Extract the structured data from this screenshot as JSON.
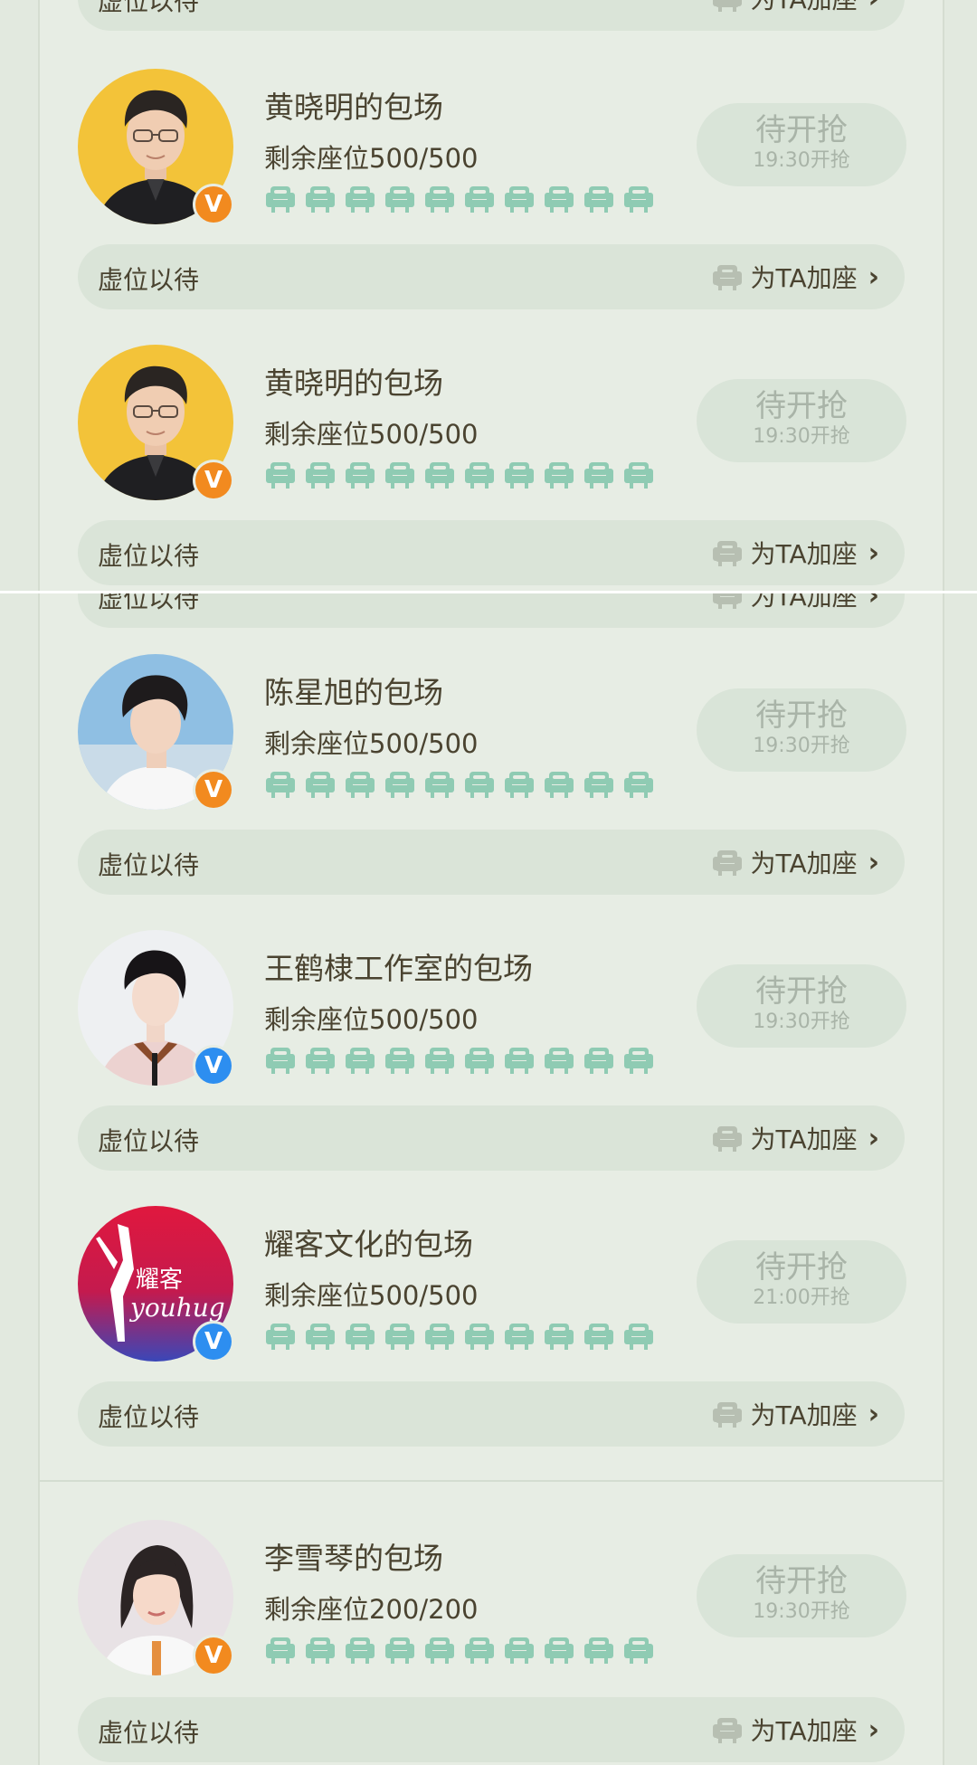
{
  "seat_color": "#8fcbb3",
  "accent_colors": {
    "badge_orange": "#f28a1f",
    "badge_blue": "#2d8ef0",
    "status_bg": "#d9e4d8",
    "strip_bg": "#dae4d8"
  },
  "top_partial_strip": {
    "left": "虚位以待",
    "right": "为TA加座"
  },
  "cut_partial_strip": {
    "left": "虚位以待",
    "right": "为TA加座"
  },
  "cards": [
    {
      "title": "黄晓明的包场",
      "seats": "剩余座位500/500",
      "status": "待开抢",
      "time": "19:30开抢",
      "badge": "V",
      "waiting": "虚位以待",
      "add_seat": "为TA加座",
      "seat_icons": 10
    },
    {
      "title": "黄晓明的包场",
      "seats": "剩余座位500/500",
      "status": "待开抢",
      "time": "19:30开抢",
      "badge": "V",
      "waiting": "虚位以待",
      "add_seat": "为TA加座",
      "seat_icons": 10
    },
    {
      "title": "陈星旭的包场",
      "seats": "剩余座位500/500",
      "status": "待开抢",
      "time": "19:30开抢",
      "badge": "V",
      "waiting": "虚位以待",
      "add_seat": "为TA加座",
      "seat_icons": 10
    },
    {
      "title": "王鹤棣工作室的包场",
      "seats": "剩余座位500/500",
      "status": "待开抢",
      "time": "19:30开抢",
      "badge": "V",
      "waiting": "虚位以待",
      "add_seat": "为TA加座",
      "seat_icons": 10
    },
    {
      "title": "耀客文化的包场",
      "seats": "剩余座位500/500",
      "status": "待开抢",
      "time": "21:00开抢",
      "badge": "V",
      "waiting": "虚位以待",
      "add_seat": "为TA加座",
      "seat_icons": 10
    },
    {
      "title": "李雪琴的包场",
      "seats": "剩余座位200/200",
      "status": "待开抢",
      "time": "19:30开抢",
      "badge": "V",
      "waiting": "虚位以待",
      "add_seat": "为TA加座",
      "seat_icons": 10
    }
  ],
  "logo_text": {
    "line1": "耀客",
    "line2": "youhug"
  },
  "icons": {
    "seat": "armchair-icon",
    "add_seat": "armchair-plus-icon",
    "chevron": "chevron-right-icon",
    "verified": "verified-v-icon"
  }
}
